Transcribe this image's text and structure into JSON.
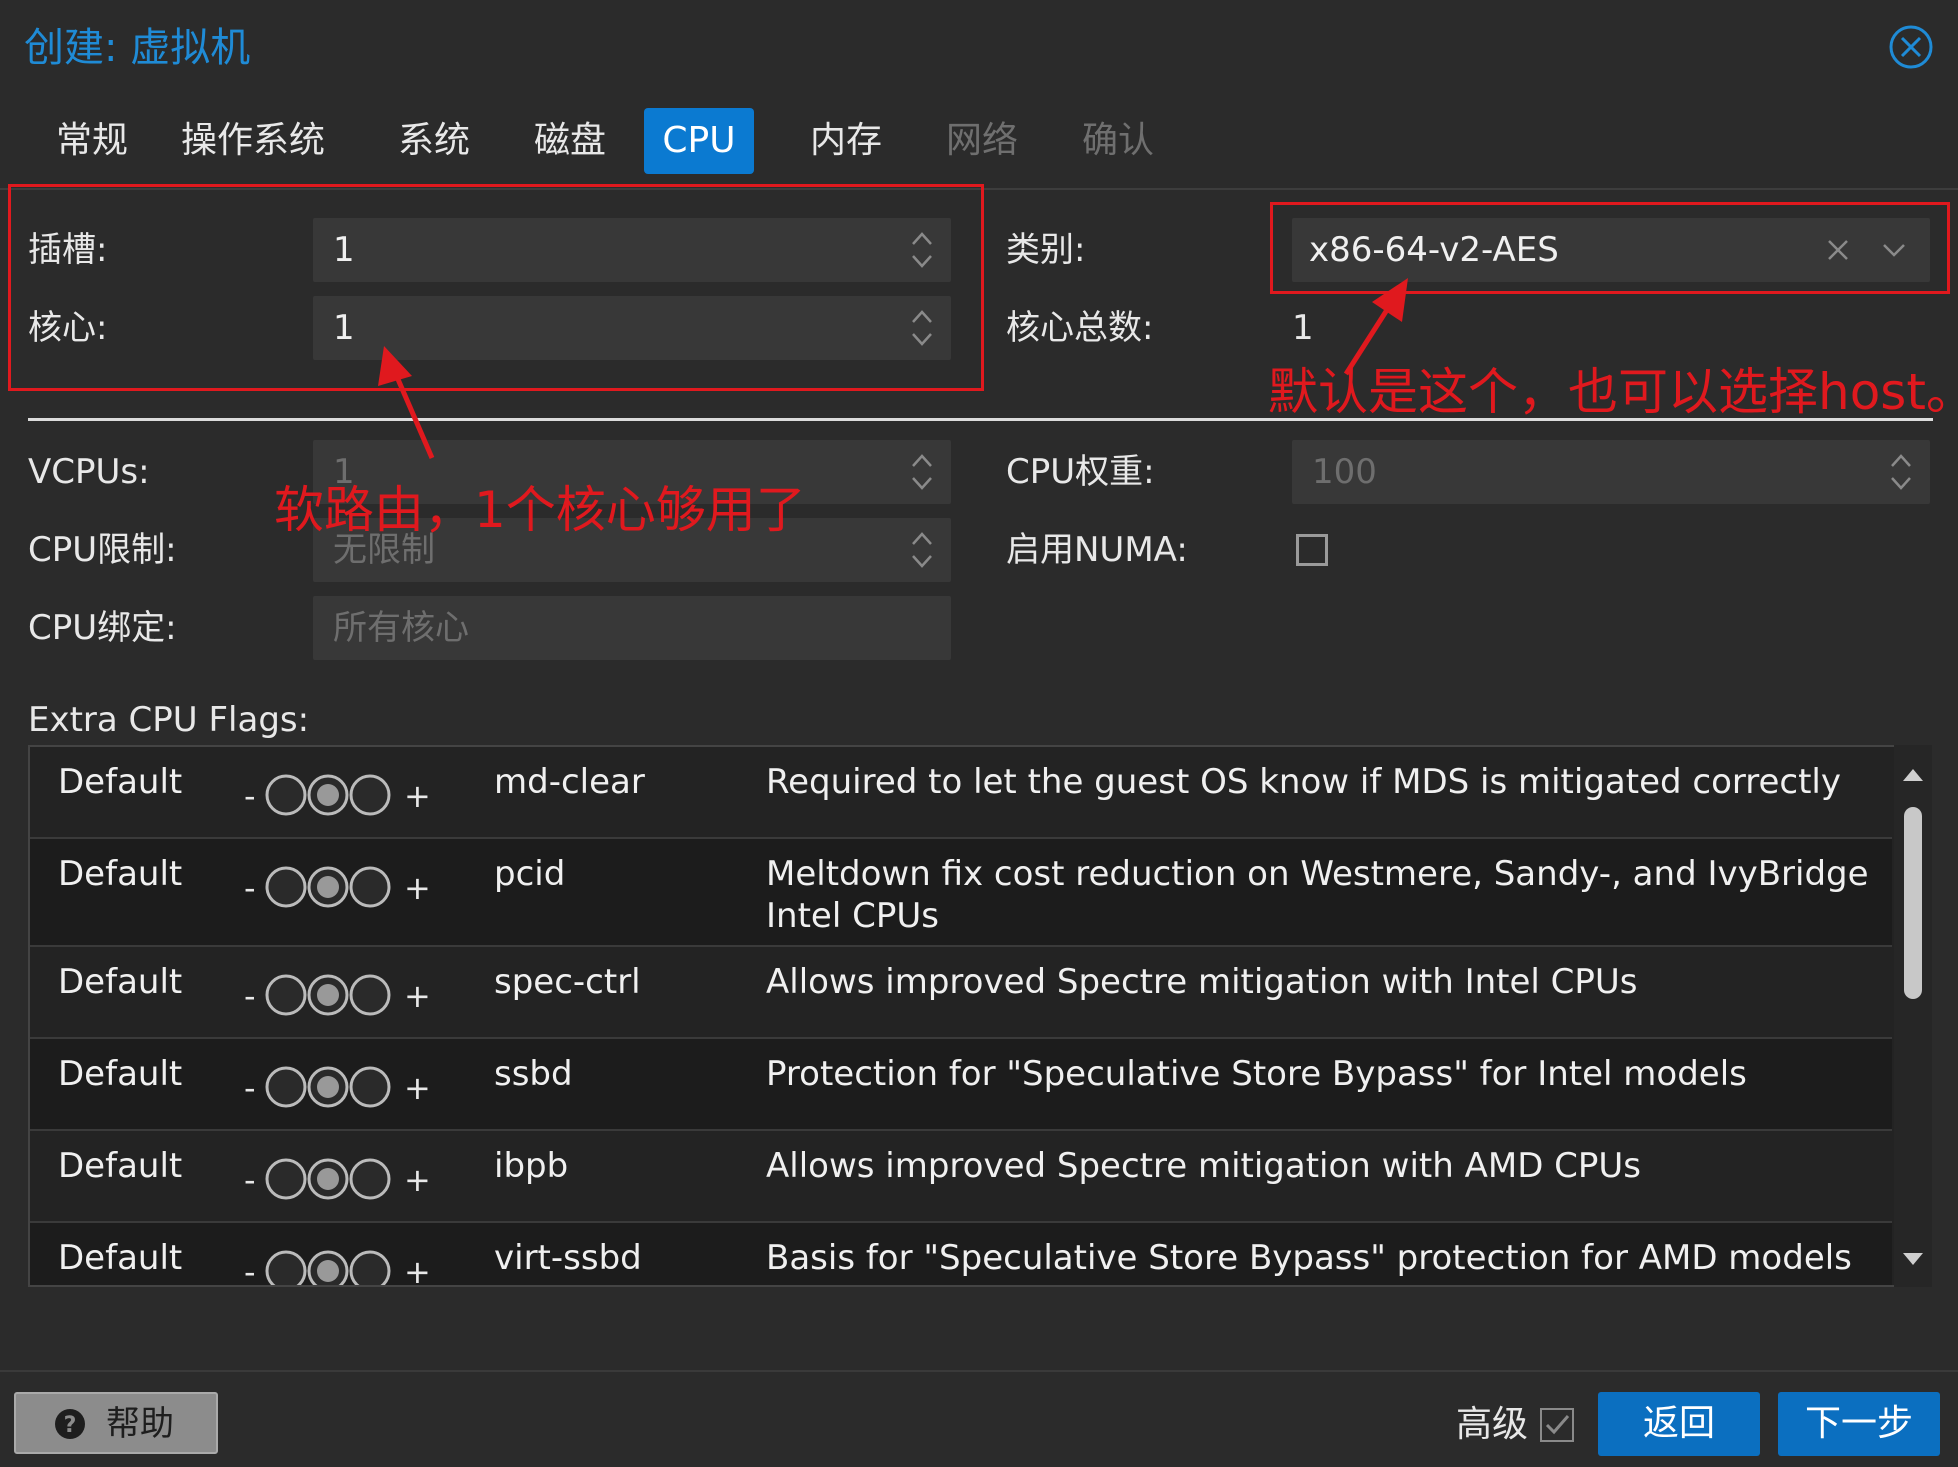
{
  "window": {
    "title": "创建: 虚拟机"
  },
  "tabs": [
    {
      "label": "常规",
      "state": "normal"
    },
    {
      "label": "操作系统",
      "state": "normal"
    },
    {
      "label": "系统",
      "state": "normal"
    },
    {
      "label": "磁盘",
      "state": "normal"
    },
    {
      "label": "CPU",
      "state": "active"
    },
    {
      "label": "内存",
      "state": "normal"
    },
    {
      "label": "网络",
      "state": "disabled"
    },
    {
      "label": "确认",
      "state": "disabled"
    }
  ],
  "form": {
    "sockets_label": "插槽:",
    "sockets_value": "1",
    "cores_label": "核心:",
    "cores_value": "1",
    "type_label": "类别:",
    "type_value": "x86-64-v2-AES",
    "total_cores_label": "核心总数:",
    "total_cores_value": "1",
    "vcpus_label": "VCPUs:",
    "vcpus_value": "1",
    "cpu_limit_label": "CPU限制:",
    "cpu_limit_placeholder": "无限制",
    "cpu_affinity_label": "CPU绑定:",
    "cpu_affinity_placeholder": "所有核心",
    "cpu_units_label": "CPU权重:",
    "cpu_units_value": "100",
    "numa_label": "启用NUMA:",
    "numa_checked": false
  },
  "annotations": {
    "left": "软路由，1个核心够用了",
    "right": "默认是这个，也可以选择host。",
    "color": "#e0191e"
  },
  "flags": {
    "section_label": "Extra CPU Flags:",
    "rows": [
      {
        "state": "Default",
        "minus": "-",
        "plus": "+",
        "flag": "md-clear",
        "desc": "Required to let the guest OS know if MDS is mitigated correctly"
      },
      {
        "state": "Default",
        "minus": "-",
        "plus": "+",
        "flag": "pcid",
        "desc": "Meltdown fix cost reduction on Westmere, Sandy-, and IvyBridge Intel CPUs"
      },
      {
        "state": "Default",
        "minus": "-",
        "plus": "+",
        "flag": "spec-ctrl",
        "desc": "Allows improved Spectre mitigation with Intel CPUs"
      },
      {
        "state": "Default",
        "minus": "-",
        "plus": "+",
        "flag": "ssbd",
        "desc": "Protection for \"Speculative Store Bypass\" for Intel models"
      },
      {
        "state": "Default",
        "minus": "-",
        "plus": "+",
        "flag": "ibpb",
        "desc": "Allows improved Spectre mitigation with AMD CPUs"
      },
      {
        "state": "Default",
        "minus": "-",
        "plus": "+",
        "flag": "virt-ssbd",
        "desc": "Basis for \"Speculative Store Bypass\" protection for AMD models"
      }
    ]
  },
  "footer": {
    "help_label": "帮助",
    "advanced_label": "高级",
    "advanced_checked": true,
    "back_label": "返回",
    "next_label": "下一步"
  },
  "colors": {
    "accent": "#0b7ad1",
    "title": "#1f8bd6",
    "background": "#2b2b2b"
  }
}
